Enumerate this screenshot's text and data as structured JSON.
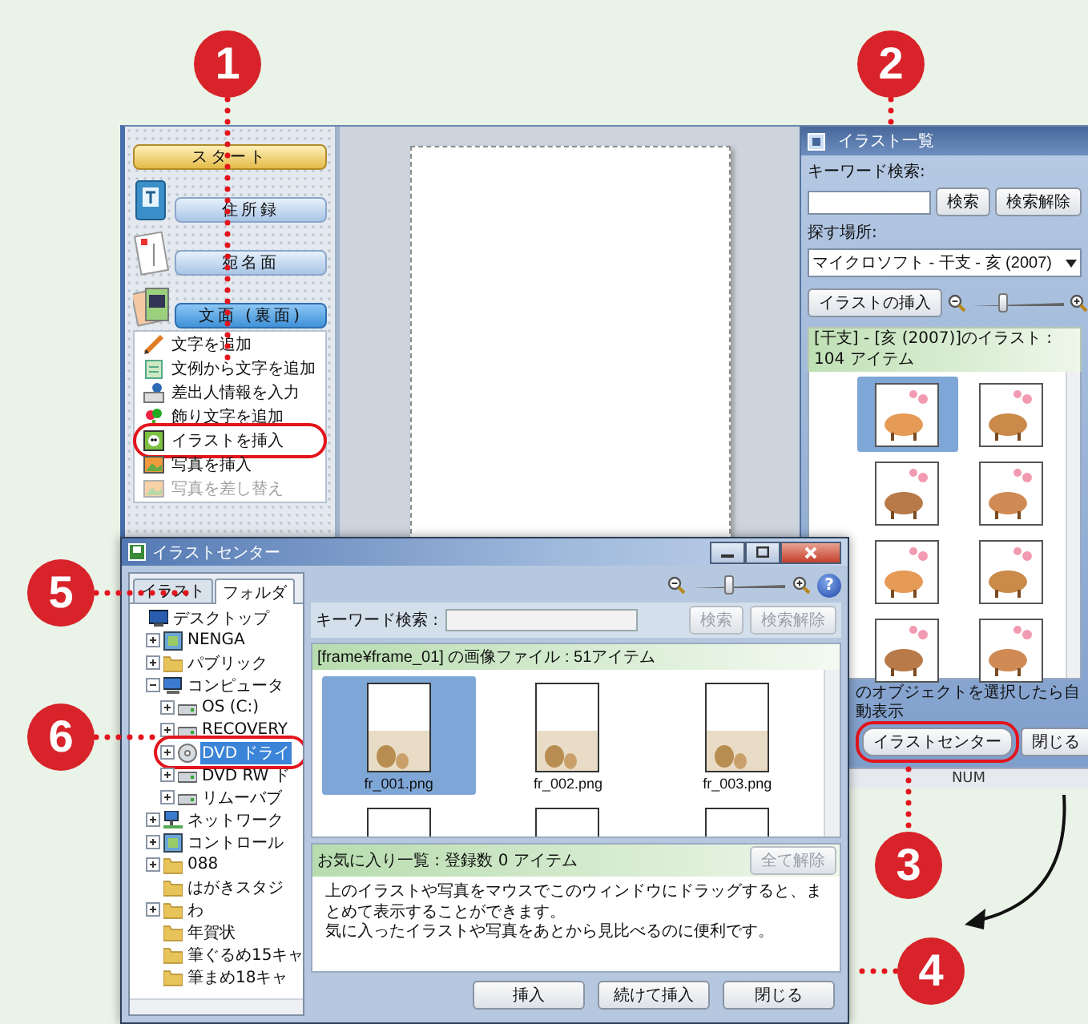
{
  "main_window": {
    "sidebar": {
      "nav": [
        {
          "label": "スタート",
          "kind": "start",
          "selected": false
        },
        {
          "label": "住所録",
          "kind": "section",
          "selected": false
        },
        {
          "label": "宛名面",
          "kind": "section",
          "selected": false
        },
        {
          "label": "文面 (裏面)",
          "kind": "section",
          "selected": true
        }
      ],
      "items": [
        {
          "label": "文字を追加",
          "disabled": false,
          "highlighted": false
        },
        {
          "label": "文例から文字を追加",
          "disabled": false,
          "highlighted": false
        },
        {
          "label": "差出人情報を入力",
          "disabled": false,
          "highlighted": false
        },
        {
          "label": "飾り文字を追加",
          "disabled": false,
          "highlighted": false
        },
        {
          "label": "イラストを挿入",
          "disabled": false,
          "highlighted": true
        },
        {
          "label": "写真を挿入",
          "disabled": false,
          "highlighted": false
        },
        {
          "label": "写真を差し替え",
          "disabled": true,
          "highlighted": false
        }
      ]
    },
    "illust_panel": {
      "title": "イラスト一覧",
      "keyword_label": "キーワード検索:",
      "search_button": "検索",
      "clear_button": "検索解除",
      "location_label": "探す場所:",
      "location_value": "マイクロソフト - 干支 - 亥 (2007)",
      "insert_button": "イラストの挿入",
      "zoom_slider": {
        "level": 0.35
      },
      "list_header": "[干支] - [亥 (2007)]のイラスト : 104 アイテム",
      "thumbnails": [
        {
          "selected": true
        },
        {
          "selected": false
        },
        {
          "selected": false
        },
        {
          "selected": false
        },
        {
          "selected": false
        },
        {
          "selected": false
        },
        {
          "selected": false
        },
        {
          "selected": false
        }
      ],
      "auto_display": "のオブジェクトを選択したら自動表示",
      "buttons": [
        {
          "label": "イラストセンター",
          "highlighted": true
        },
        {
          "label": "閉じる",
          "highlighted": false
        }
      ],
      "status": "NUM"
    }
  },
  "dialog": {
    "title": "イラストセンター",
    "tabs": [
      {
        "label": "イラスト",
        "selected": false
      },
      {
        "label": "フォルダ",
        "selected": true
      }
    ],
    "tree": [
      {
        "label": "デスクトップ",
        "kind": "desktop",
        "selected": false,
        "highlighted": false,
        "children": [
          {
            "label": "NENGA",
            "kind": "window",
            "expanded": false,
            "selected": false,
            "highlighted": false
          },
          {
            "label": "パブリック",
            "kind": "folder",
            "expanded": false,
            "selected": false,
            "highlighted": false
          },
          {
            "label": "コンピュータ",
            "kind": "computer",
            "expanded": true,
            "selected": false,
            "highlighted": false,
            "children": [
              {
                "label": "OS (C:)",
                "kind": "drive",
                "expanded": false,
                "selected": false,
                "highlighted": false
              },
              {
                "label": "RECOVERY",
                "kind": "drive",
                "expanded": false,
                "selected": false,
                "highlighted": false
              },
              {
                "label": "DVD ドライ",
                "kind": "disc",
                "expanded": false,
                "selected": true,
                "highlighted": true
              },
              {
                "label": "DVD RW ド",
                "kind": "drive",
                "expanded": false,
                "selected": false,
                "highlighted": false
              },
              {
                "label": "リムーバブ",
                "kind": "drive",
                "expanded": false,
                "selected": false,
                "highlighted": false
              }
            ]
          },
          {
            "label": "ネットワーク",
            "kind": "network",
            "expanded": false,
            "selected": false,
            "highlighted": false
          },
          {
            "label": "コントロール",
            "kind": "window",
            "expanded": false,
            "selected": false,
            "highlighted": false
          },
          {
            "label": "088",
            "kind": "folder",
            "expanded": false,
            "selected": false,
            "highlighted": false
          },
          {
            "label": "はがきスタジ",
            "kind": "folder",
            "selected": false,
            "highlighted": false
          },
          {
            "label": "わ",
            "kind": "folder",
            "expanded": false,
            "selected": false,
            "highlighted": false
          },
          {
            "label": "年賀状",
            "kind": "folder",
            "selected": false,
            "highlighted": false
          },
          {
            "label": "筆ぐるめ15キャ",
            "kind": "folder",
            "selected": false,
            "highlighted": false
          },
          {
            "label": "筆まめ18キャ",
            "kind": "folder",
            "selected": false,
            "highlighted": false
          }
        ]
      }
    ],
    "zoom_slider": {
      "level": 0.4
    },
    "help": "?",
    "keyword_label": "キーワード検索 :",
    "search_button": {
      "label": "検索",
      "disabled": true
    },
    "clear_button": {
      "label": "検索解除",
      "disabled": true
    },
    "list_header": "[frame¥frame_01] の画像ファイル : 51アイテム",
    "files": [
      {
        "name": "fr_001.png",
        "selected": true
      },
      {
        "name": "fr_002.png",
        "selected": false
      },
      {
        "name": "fr_003.png",
        "selected": false
      }
    ],
    "favorites_header": "お気に入り一覧 : 登録数 0 アイテム",
    "clear_all_button": {
      "label": "全て解除",
      "disabled": true
    },
    "favorites_text": [
      "上のイラストや写真をマウスでこのウィンドウにドラッグすると、まとめて表示することができます。",
      "気に入ったイラストや写真をあとから見比べるのに便利です。"
    ],
    "buttons": [
      "挿入",
      "続けて挿入",
      "閉じる"
    ]
  },
  "callouts": [
    {
      "number": "1"
    },
    {
      "number": "2"
    },
    {
      "number": "3"
    },
    {
      "number": "4"
    },
    {
      "number": "5"
    },
    {
      "number": "6"
    }
  ]
}
